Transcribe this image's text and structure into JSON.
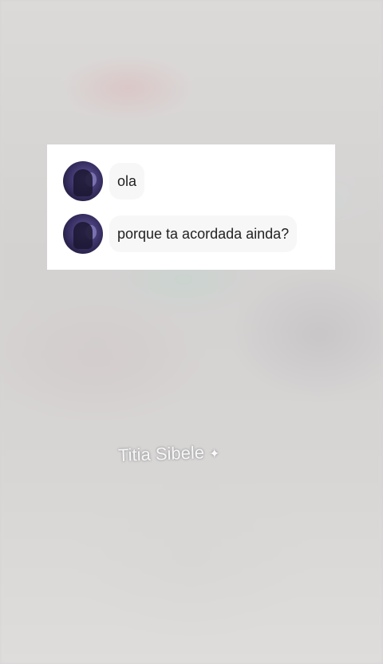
{
  "messages": [
    {
      "text": "ola",
      "avatar_icon": "profile-avatar"
    },
    {
      "text": "porque ta acordada ainda?",
      "avatar_icon": "profile-avatar"
    }
  ],
  "caption": {
    "text": "Titia Sibele",
    "sparkle": "✦"
  },
  "colors": {
    "card_background": "#ffffff",
    "bubble_background": "#f7f7f8",
    "page_background": "#d6d3d3"
  }
}
